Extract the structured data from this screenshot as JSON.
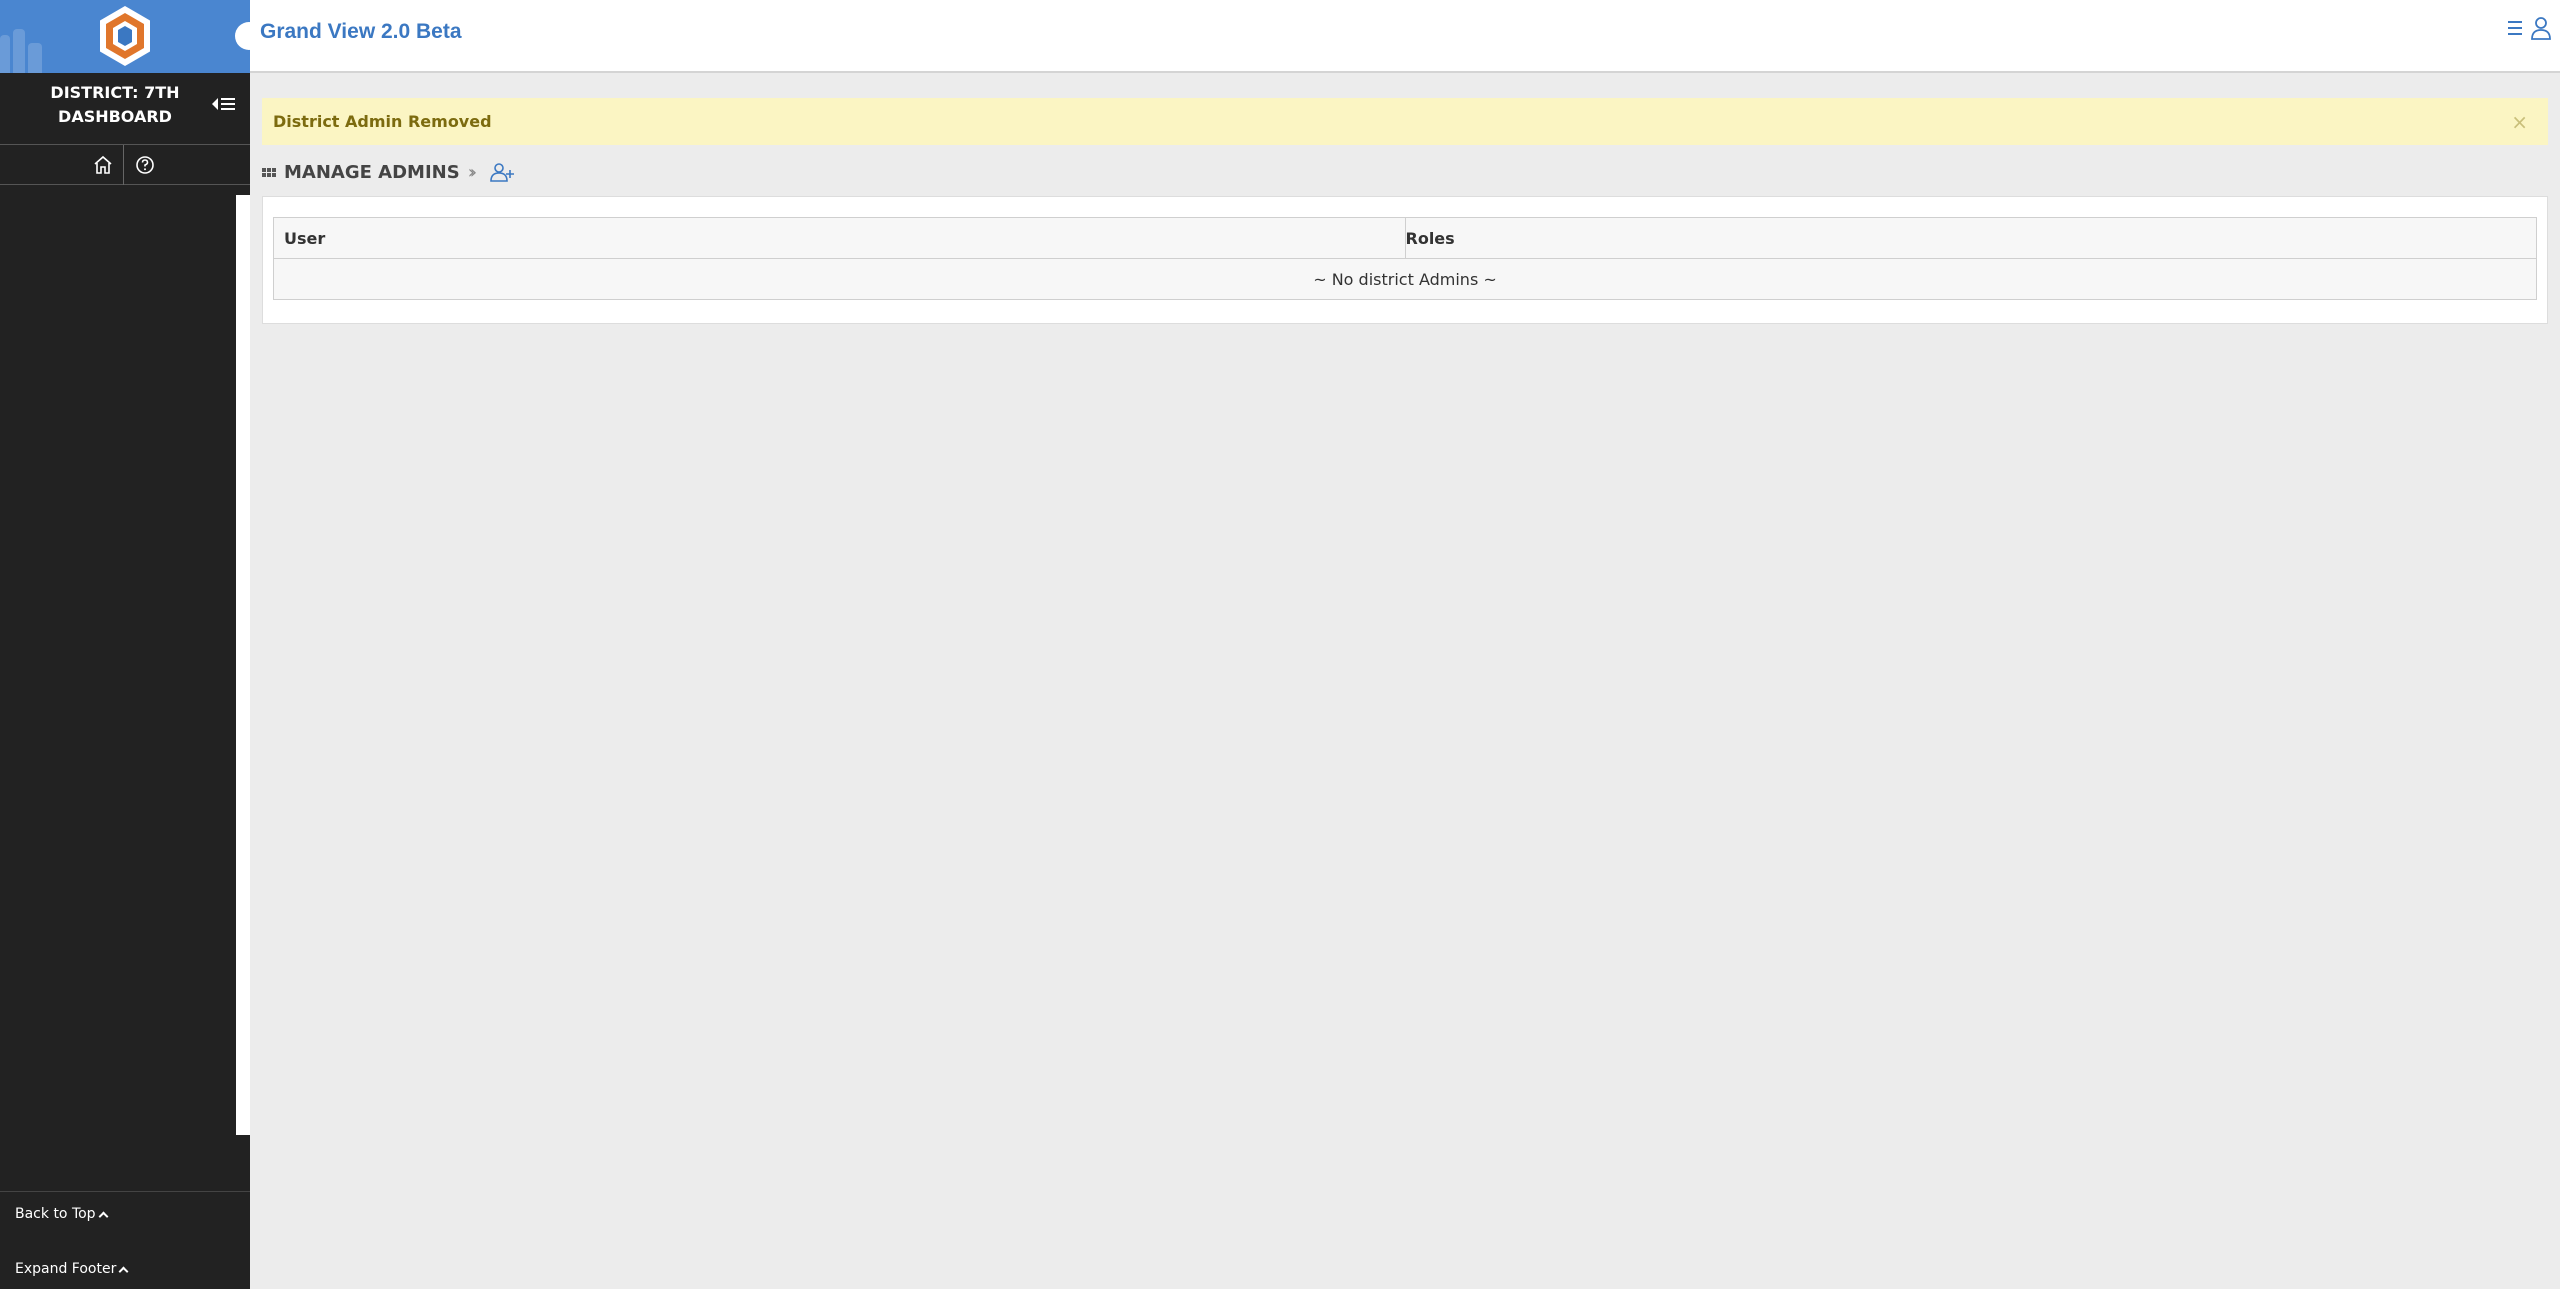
{
  "app": {
    "title": "Grand View 2.0 Beta"
  },
  "sidebar": {
    "district_title": "DISTRICT: 7TH DASHBOARD",
    "nav_icons": [
      "home-icon",
      "help-icon"
    ],
    "footer": {
      "back_to_top": "Back to Top",
      "expand_footer": "Expand Footer"
    }
  },
  "alert": {
    "message": "District Admin Removed",
    "close": "×"
  },
  "section": {
    "title": "MANAGE ADMINS",
    "separator": "»"
  },
  "table": {
    "headers": [
      "User",
      "Roles"
    ],
    "empty_message": "~ No district Admins ~"
  },
  "colors": {
    "sidebar_bg": "#222222",
    "logo_bg": "#4a86d0",
    "accent": "#3b78c2",
    "alert_bg": "#fbf5c3",
    "logo_orange": "#e0762b"
  }
}
